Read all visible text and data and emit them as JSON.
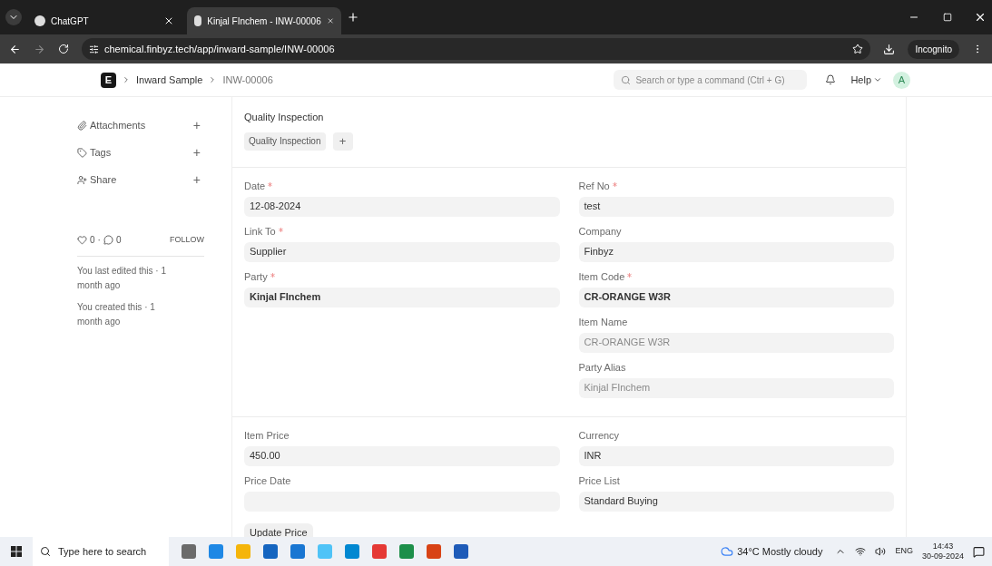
{
  "browser": {
    "tabs": [
      {
        "title": "ChatGPT",
        "selected": false
      },
      {
        "title": "Kinjal FInchem - INW-00006",
        "selected": true
      }
    ],
    "url": "chemical.finbyz.tech/app/inward-sample/INW-00006",
    "incognito_label": "Incognito"
  },
  "header": {
    "logo": "E",
    "breadcrumbs": [
      "Inward Sample",
      "INW-00006"
    ],
    "search_placeholder": "Search or type a command (Ctrl + G)",
    "help": "Help",
    "avatar": "A"
  },
  "sidebar": {
    "actions": [
      {
        "kind": "attachments",
        "label": "Attachments",
        "add": "+"
      },
      {
        "kind": "tags",
        "label": "Tags",
        "add": "+"
      },
      {
        "kind": "share",
        "label": "Share",
        "add": "+"
      }
    ],
    "likes": "0",
    "separator": "·",
    "comments": "0",
    "follow": "FOLLOW",
    "activity": [
      "You last edited this · 1 month ago",
      "You created this · 1 month ago"
    ]
  },
  "quality_inspection": {
    "title": "Quality Inspection",
    "chip": "Quality Inspection",
    "add": "+"
  },
  "sections": [
    {
      "left": [
        {
          "label": "Date",
          "value": "12-08-2024",
          "required": true,
          "bold": false,
          "read_only": false
        },
        {
          "label": "Link To",
          "value": "Supplier",
          "required": true,
          "bold": false,
          "read_only": false
        },
        {
          "label": "Party",
          "value": "Kinjal FInchem",
          "required": true,
          "bold": true,
          "read_only": false
        }
      ],
      "right": [
        {
          "label": "Ref No",
          "value": "test",
          "required": true,
          "bold": false,
          "read_only": false
        },
        {
          "label": "Company",
          "value": "Finbyz",
          "required": false,
          "bold": false,
          "read_only": false
        },
        {
          "label": "Item Code",
          "value": "CR-ORANGE W3R",
          "required": true,
          "bold": true,
          "read_only": false
        },
        {
          "label": "Item Name",
          "value": "CR-ORANGE W3R",
          "required": false,
          "bold": false,
          "read_only": true
        },
        {
          "label": "Party Alias",
          "value": "Kinjal FInchem",
          "required": false,
          "bold": false,
          "read_only": true
        }
      ]
    },
    {
      "left": [
        {
          "label": "Item Price",
          "value": "450.00",
          "required": false,
          "bold": false,
          "read_only": false
        },
        {
          "label": "Price Date",
          "required": false
        }
      ],
      "right": [
        {
          "label": "Currency",
          "value": "INR",
          "required": false,
          "bold": false,
          "read_only": false
        },
        {
          "label": "Price List",
          "value": "Standard Buying",
          "required": false,
          "bold": false,
          "read_only": false
        }
      ],
      "button": "Update Price"
    }
  ],
  "taskbar": {
    "search_placeholder": "Type here to search",
    "weather": "34°C Mostly cloudy",
    "language": "ENG",
    "time": "14:43",
    "date": "30-09-2024"
  }
}
